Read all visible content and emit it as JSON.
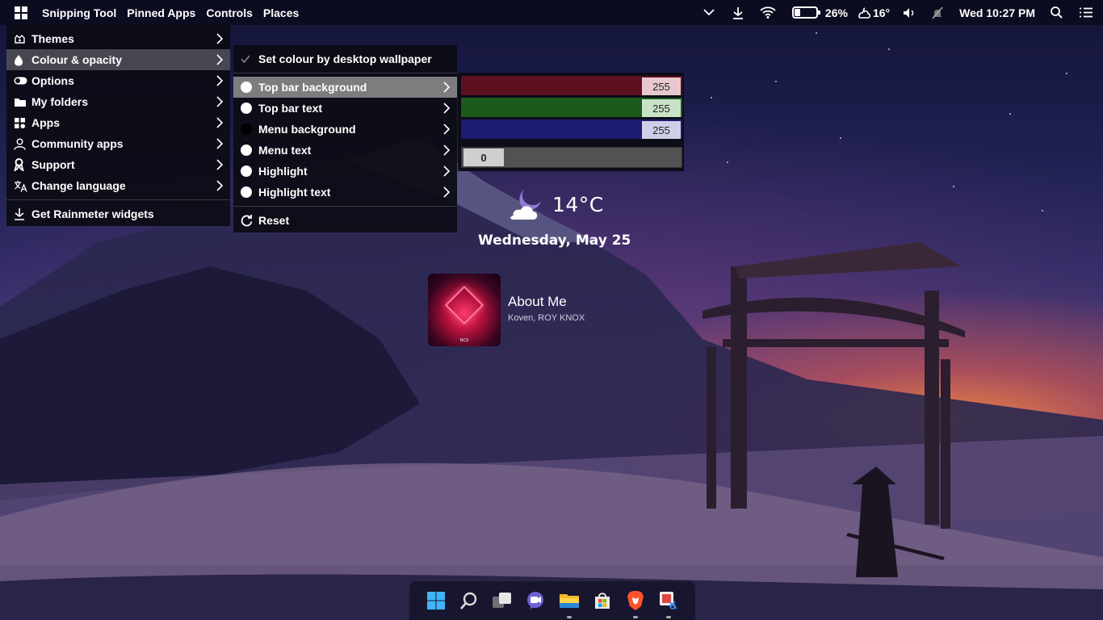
{
  "topbar": {
    "left_items": [
      "Snipping Tool",
      "Pinned Apps",
      "Controls",
      "Places"
    ],
    "battery_percent": "26%",
    "battery_level": 0.26,
    "weather_temp": "16°",
    "clock": "Wed 10:27 PM"
  },
  "main_menu": {
    "items": [
      {
        "label": "Themes",
        "icon": "themes-icon"
      },
      {
        "label": "Colour & opacity",
        "icon": "droplet-icon"
      },
      {
        "label": "Options",
        "icon": "toggle-icon"
      },
      {
        "label": "My folders",
        "icon": "folder-icon"
      },
      {
        "label": "Apps",
        "icon": "apps-icon"
      },
      {
        "label": "Community apps",
        "icon": "person-icon"
      },
      {
        "label": "Support",
        "icon": "ribbon-icon"
      },
      {
        "label": "Change language",
        "icon": "translate-icon"
      }
    ],
    "footer_item": "Get Rainmeter widgets"
  },
  "colour_menu": {
    "wallpaper_option": "Set colour by desktop wallpaper",
    "items": [
      {
        "label": "Top bar background",
        "swatch": "#ffffff"
      },
      {
        "label": "Top bar text",
        "swatch": "#ffffff"
      },
      {
        "label": "Menu background",
        "swatch": "#000000"
      },
      {
        "label": "Menu text",
        "swatch": "#ffffff"
      },
      {
        "label": "Highlight",
        "swatch": "#ffffff"
      },
      {
        "label": "Highlight text",
        "swatch": "#ffffff"
      }
    ],
    "reset": "Reset"
  },
  "colour_picker": {
    "red": "255",
    "green": "255",
    "blue": "255",
    "alpha": "0",
    "colors": {
      "red": "#5c1020",
      "green": "#1c5a1c",
      "blue": "#1c1c72",
      "alpha_bg": "#525252"
    }
  },
  "weather_widget": {
    "temperature": "14°C",
    "date": "Wednesday, May 25"
  },
  "music_widget": {
    "title": "About Me",
    "artist": "Koven, ROY KNOX"
  },
  "taskbar": {
    "icons": [
      "windows-start-icon",
      "search-icon",
      "task-view-icon",
      "teams-chat-icon",
      "file-explorer-icon",
      "microsoft-store-icon",
      "brave-browser-icon",
      "snipping-tool-icon"
    ]
  }
}
